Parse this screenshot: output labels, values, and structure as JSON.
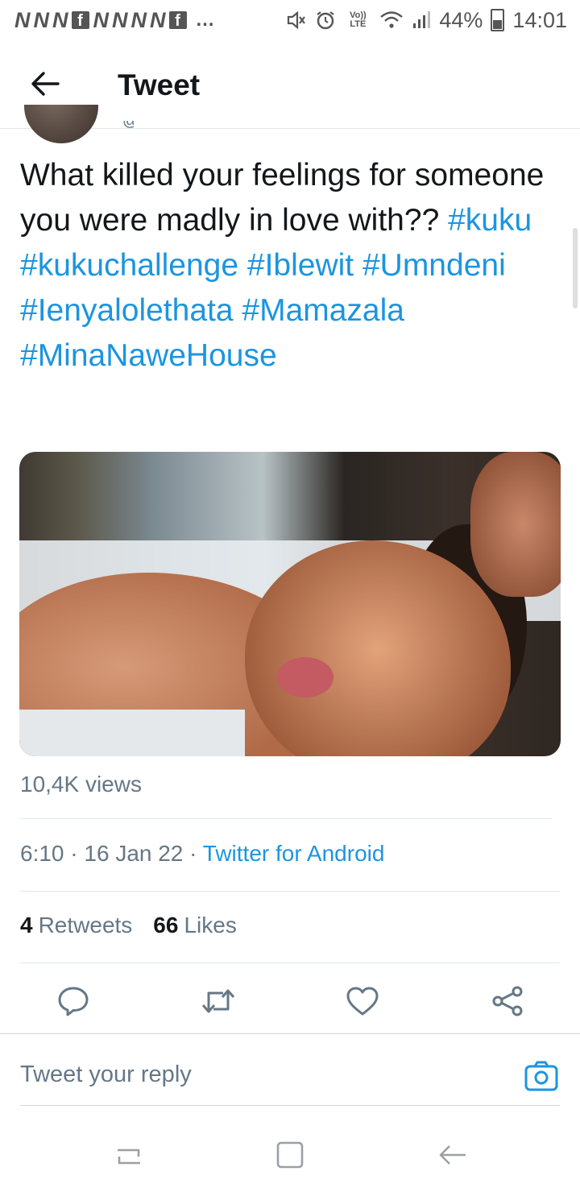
{
  "status_bar": {
    "notification_letters": [
      "N",
      "N",
      "N",
      "f",
      "N",
      "N",
      "N",
      "N",
      "f"
    ],
    "overflow": "…",
    "volte": "Vo)) LTE",
    "battery": "44%",
    "time": "14:01"
  },
  "header": {
    "title": "Tweet"
  },
  "tweet": {
    "text_plain": "What killed your feelings for someone you were madly in love with??",
    "hashtags": [
      "#kuku",
      "#kukuchallenge",
      "#Iblewit",
      "#Umndeni",
      "#Ienyalolethata",
      "#Mamazala",
      "#MinaNaweHouse"
    ],
    "views": "10,4K views",
    "time": "6:10",
    "separator": "·",
    "date": "16 Jan 22",
    "source": "Twitter for Android",
    "retweets_count": "4",
    "retweets_label": "Retweets",
    "likes_count": "66",
    "likes_label": "Likes"
  },
  "reply": {
    "placeholder": "Tweet your reply"
  },
  "icons": {
    "back": "arrow-left-icon",
    "reply": "comment-icon",
    "retweet": "retweet-icon",
    "like": "heart-icon",
    "share": "share-icon",
    "camera": "camera-icon",
    "nav_recents": "recents-icon",
    "nav_home": "home-icon",
    "nav_back": "back-icon"
  },
  "colors": {
    "accent": "#1b95e0",
    "text": "#14171a",
    "muted": "#657786",
    "divider": "#e1e8ed"
  }
}
